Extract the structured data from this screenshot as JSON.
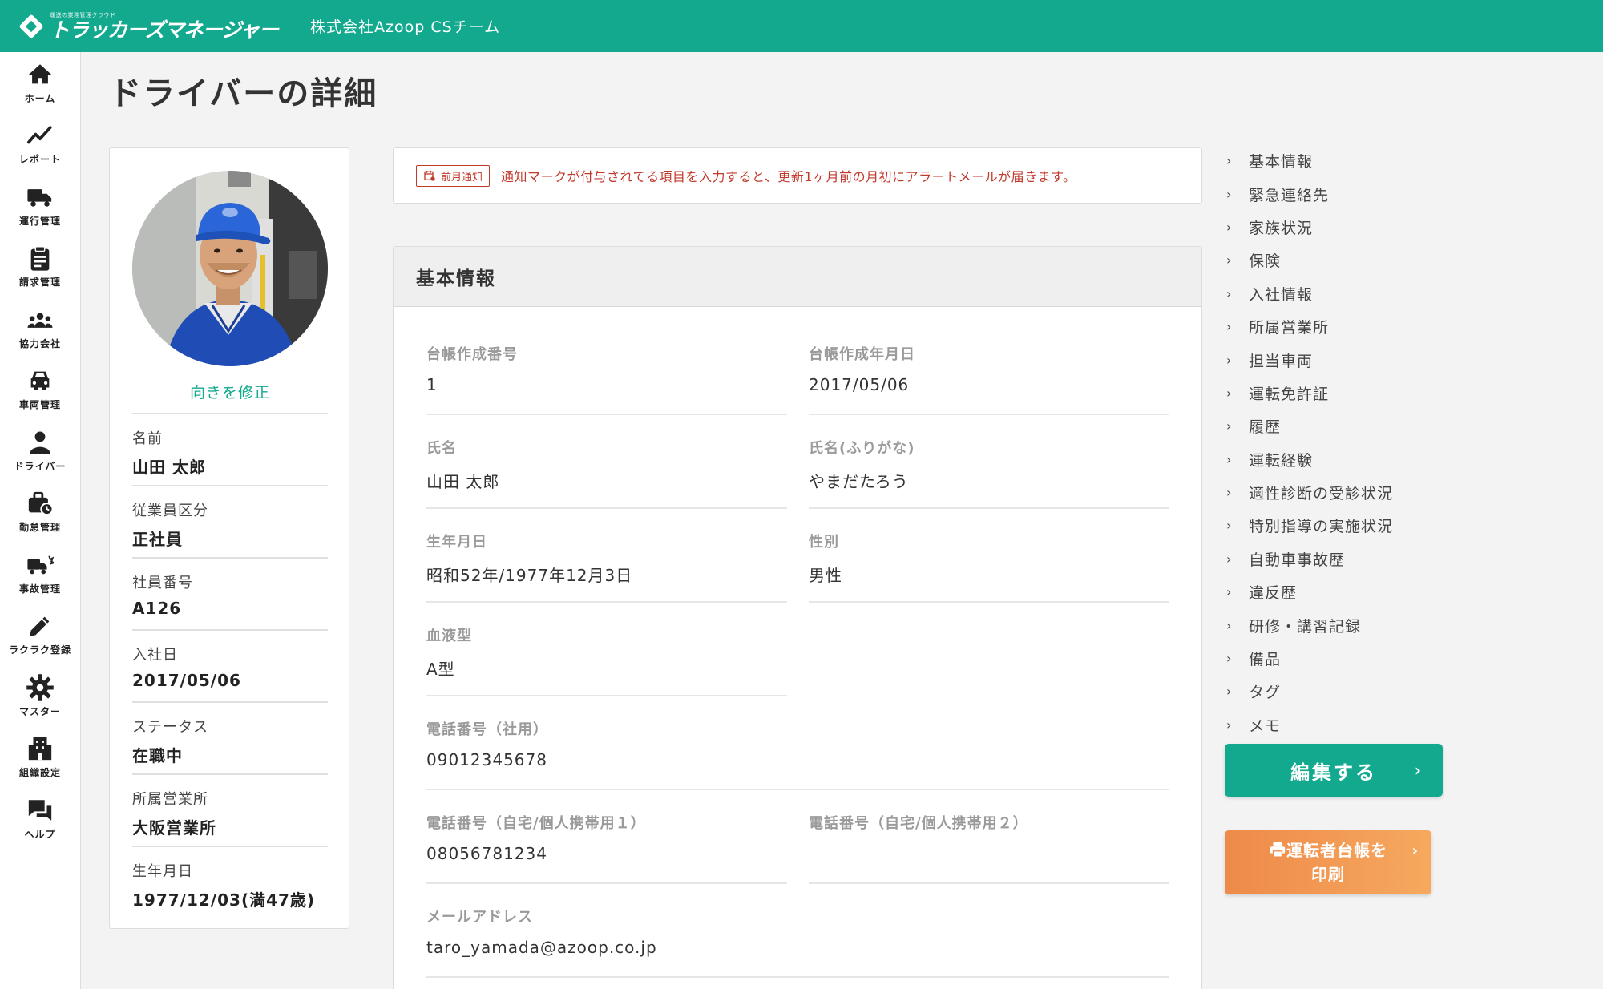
{
  "header": {
    "logo_tagline": "運送の業務管理クラウド",
    "logo_text": "トラッカーズマネージャー",
    "company": "株式会社Azoop CSチーム",
    "color": "#13a98e"
  },
  "sidenav": [
    {
      "label": "ホーム",
      "icon": "home-icon"
    },
    {
      "label": "レポート",
      "icon": "chart-line-icon"
    },
    {
      "label": "運行管理",
      "icon": "truck-icon"
    },
    {
      "label": "請求管理",
      "icon": "clipboard-icon"
    },
    {
      "label": "協力会社",
      "icon": "users-icon"
    },
    {
      "label": "車両管理",
      "icon": "car-icon"
    },
    {
      "label": "ドライバー",
      "icon": "person-icon"
    },
    {
      "label": "勤怠管理",
      "icon": "briefcase-clock-icon"
    },
    {
      "label": "事故管理",
      "icon": "truck-crash-icon"
    },
    {
      "label": "ラクラク登録",
      "icon": "pencil-icon"
    },
    {
      "label": "マスター",
      "icon": "gear-icon"
    },
    {
      "label": "組織設定",
      "icon": "building-icon"
    },
    {
      "label": "ヘルプ",
      "icon": "chat-icon"
    }
  ],
  "page_title": "ドライバーの詳細",
  "profile": {
    "rotate_link": "向きを修正",
    "fields": [
      {
        "label": "名前",
        "value": "山田 太郎"
      },
      {
        "label": "従業員区分",
        "value": "正社員"
      },
      {
        "label": "社員番号",
        "value": "A126"
      },
      {
        "label": "入社日",
        "value": "2017/05/06"
      },
      {
        "label": "ステータス",
        "value": "在職中"
      },
      {
        "label": "所属営業所",
        "value": "大阪営業所"
      },
      {
        "label": "生年月日",
        "value": "1977/12/03(満47歳)"
      }
    ]
  },
  "notice": {
    "badge": "前月通知",
    "text": "通知マークが付与されてる項目を入力すると、更新1ヶ月前の月初にアラートメールが届きます。",
    "color": "#c0392b"
  },
  "basic_info": {
    "title": "基本情報",
    "fields": [
      {
        "label": "台帳作成番号",
        "value": "1"
      },
      {
        "label": "台帳作成年月日",
        "value": "2017/05/06"
      },
      {
        "label": "氏名",
        "value": "山田 太郎"
      },
      {
        "label": "氏名(ふりがな)",
        "value": "やまだたろう"
      },
      {
        "label": "生年月日",
        "value": "昭和52年/1977年12月3日"
      },
      {
        "label": "性別",
        "value": "男性"
      },
      {
        "label": "血液型",
        "value": "A型"
      },
      {
        "label": "電話番号（社用）",
        "value": "09012345678"
      },
      {
        "label": "電話番号（自宅/個人携帯用１）",
        "value": "08056781234"
      },
      {
        "label": "電話番号（自宅/個人携帯用２）",
        "value": ""
      },
      {
        "label": "メールアドレス",
        "value": "taro_yamada@azoop.co.jp"
      }
    ]
  },
  "anchors": [
    "基本情報",
    "緊急連絡先",
    "家族状況",
    "保険",
    "入社情報",
    "所属営業所",
    "担当車両",
    "運転免許証",
    "履歴",
    "運転経験",
    "適性診断の受診状況",
    "特別指導の実施状況",
    "自動車事故歴",
    "違反歴",
    "研修・講習記録",
    "備品",
    "タグ",
    "メモ"
  ],
  "buttons": {
    "edit": "編集する",
    "print_line1": "運転者台帳を",
    "print_line2": "印刷"
  }
}
